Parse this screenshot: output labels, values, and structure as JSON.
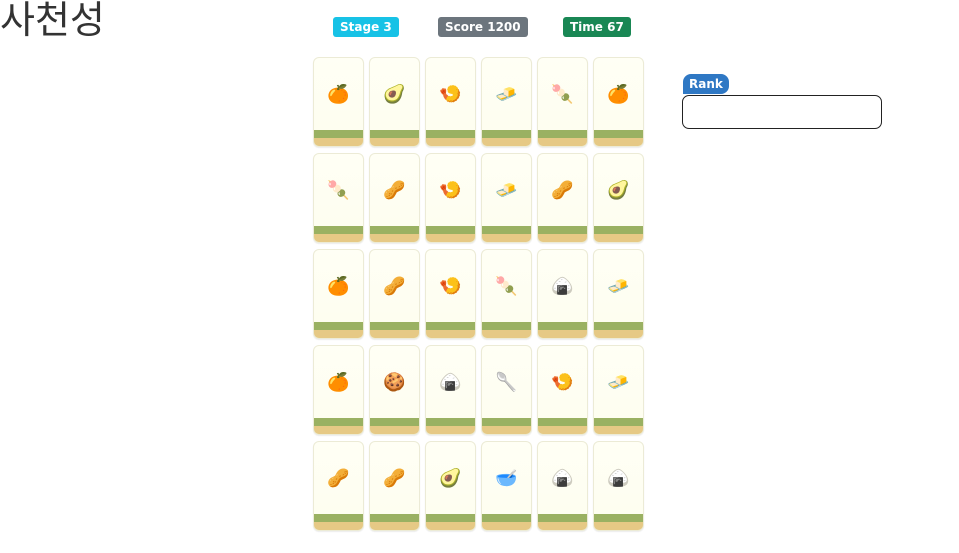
{
  "title": "사천성",
  "badges": {
    "stage": "Stage 3",
    "score": "Score 1200",
    "time": "Time 67"
  },
  "colors": {
    "stage": "#17c2e6",
    "score": "#6c757d",
    "time": "#198754",
    "rank": "#2f78c4"
  },
  "rank": {
    "label": "Rank",
    "value": ""
  },
  "board": {
    "tiles": [
      {
        "name": "orange-icon",
        "glyph": "🍊"
      },
      {
        "name": "avocado-icon",
        "glyph": "🥑"
      },
      {
        "name": "shrimp-icon",
        "glyph": "🍤"
      },
      {
        "name": "butter-icon",
        "glyph": "🧈"
      },
      {
        "name": "dango-icon",
        "glyph": "🍡"
      },
      {
        "name": "orange-icon",
        "glyph": "🍊"
      },
      {
        "name": "dango-icon",
        "glyph": "🍡"
      },
      {
        "name": "peanuts-icon",
        "glyph": "🥜"
      },
      {
        "name": "shrimp-icon",
        "glyph": "🍤"
      },
      {
        "name": "butter-icon",
        "glyph": "🧈"
      },
      {
        "name": "peanuts-icon",
        "glyph": "🥜"
      },
      {
        "name": "avocado-icon",
        "glyph": "🥑"
      },
      {
        "name": "orange-icon",
        "glyph": "🍊"
      },
      {
        "name": "peanuts-icon",
        "glyph": "🥜"
      },
      {
        "name": "shrimp-icon",
        "glyph": "🍤"
      },
      {
        "name": "dango-icon",
        "glyph": "🍡"
      },
      {
        "name": "rice-ball-icon",
        "glyph": "🍙"
      },
      {
        "name": "butter-icon",
        "glyph": "🧈"
      },
      {
        "name": "orange-icon",
        "glyph": "🍊"
      },
      {
        "name": "cookie-icon",
        "glyph": "🍪"
      },
      {
        "name": "rice-ball-icon",
        "glyph": "🍙"
      },
      {
        "name": "spoon-icon",
        "glyph": "🥄"
      },
      {
        "name": "shrimp-icon",
        "glyph": "🍤"
      },
      {
        "name": "butter-icon",
        "glyph": "🧈"
      },
      {
        "name": "peanuts-icon",
        "glyph": "🥜"
      },
      {
        "name": "peanuts-icon",
        "glyph": "🥜"
      },
      {
        "name": "avocado-icon",
        "glyph": "🥑"
      },
      {
        "name": "bowl-icon",
        "glyph": "🥣"
      },
      {
        "name": "rice-ball-icon",
        "glyph": "🍙"
      },
      {
        "name": "rice-ball-icon",
        "glyph": "🍙"
      }
    ]
  }
}
